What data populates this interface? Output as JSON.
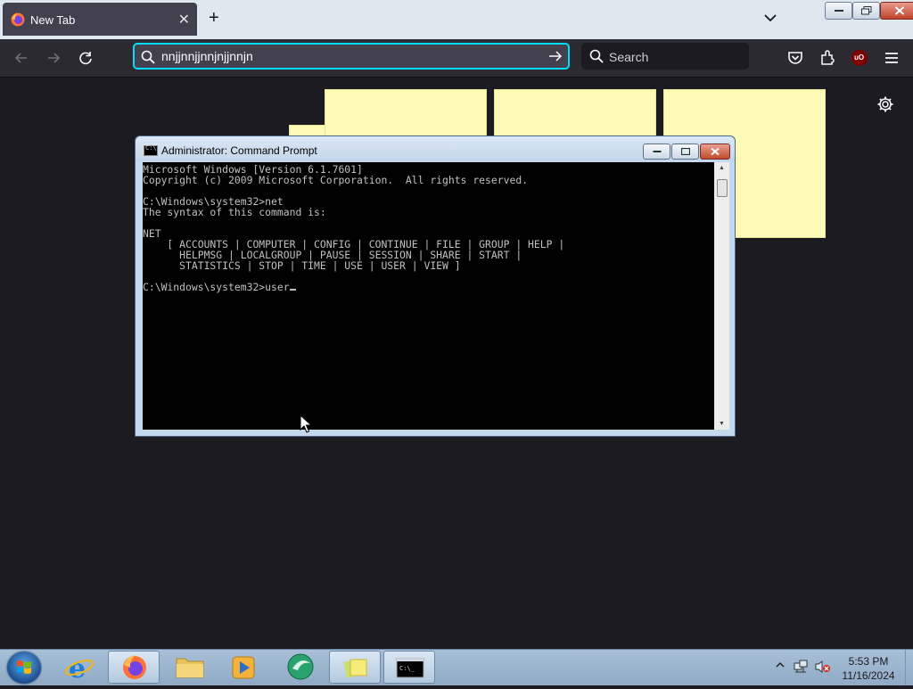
{
  "browser": {
    "tab": {
      "title": "New Tab"
    },
    "urlbar": {
      "value": "nnjjnnjjnnjnjjnnjn"
    },
    "search": {
      "placeholder": "Search"
    }
  },
  "cmd": {
    "title": "Administrator: Command Prompt",
    "lines": [
      "Microsoft Windows [Version 6.1.7601]",
      "Copyright (c) 2009 Microsoft Corporation.  All rights reserved.",
      "",
      "C:\\Windows\\system32>net",
      "The syntax of this command is:",
      "",
      "NET",
      "    [ ACCOUNTS | COMPUTER | CONFIG | CONTINUE | FILE | GROUP | HELP |",
      "      HELPMSG | LOCALGROUP | PAUSE | SESSION | SHARE | START |",
      "      STATISTICS | STOP | TIME | USE | USER | VIEW ]",
      "",
      "C:\\Windows\\system32>user"
    ]
  },
  "taskbar": {
    "time": "5:53 PM",
    "date": "11/16/2024"
  },
  "colors": {
    "urlbar_focus": "#00ddff",
    "sticky_note": "#fdfab7",
    "page_bg": "#1c1b22"
  }
}
